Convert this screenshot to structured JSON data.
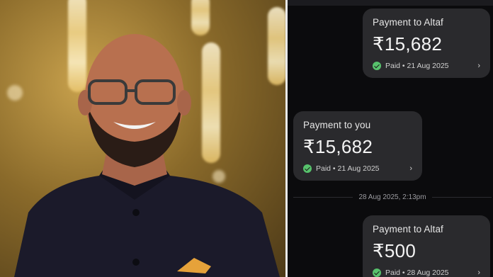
{
  "chat": {
    "messages": [
      {
        "title": "Payment to Altaf",
        "amount": "₹15,682",
        "status": "Paid • 21 Aug 2025"
      },
      {
        "title": "Payment to you",
        "amount": "₹15,682",
        "status": "Paid • 21 Aug 2025"
      },
      {
        "title": "Payment to Altaf",
        "amount": "₹500",
        "status": "Paid • 28 Aug 2025"
      }
    ],
    "date_separator": "28 Aug 2025, 2:13pm",
    "colors": {
      "card": "#2a2a2d",
      "check": "#57c26c",
      "background": "#0b0b0d"
    }
  }
}
